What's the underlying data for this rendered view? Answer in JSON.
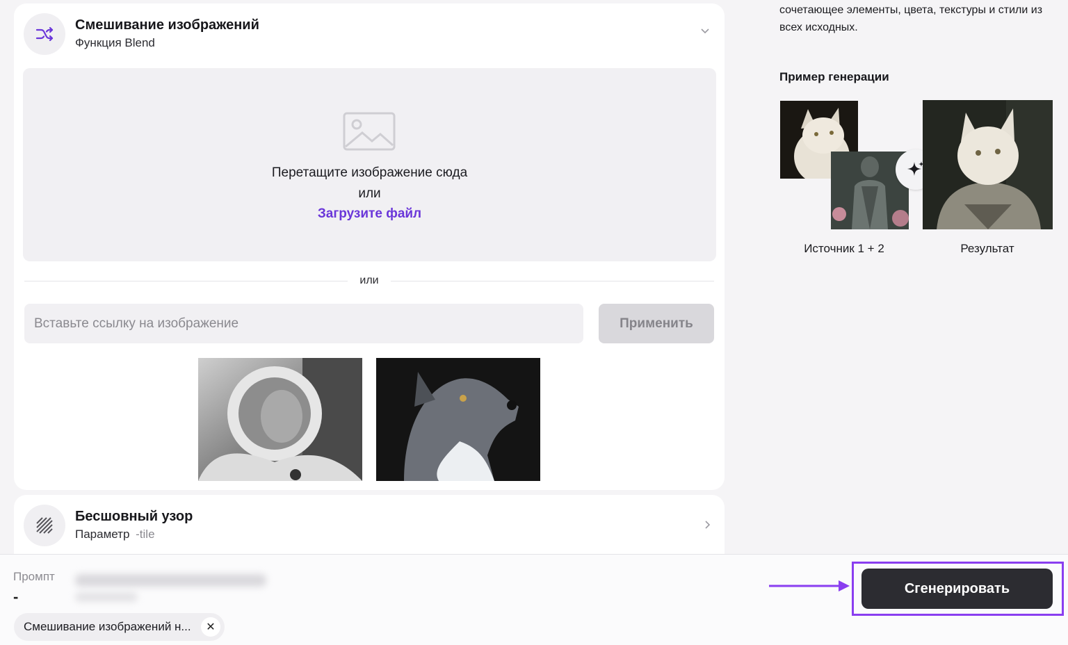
{
  "blend_section": {
    "title": "Смешивание изображений",
    "subtitle": "Функция Blend",
    "dropzone": {
      "line1": "Перетащите изображение сюда",
      "line2": "или",
      "upload_link": "Загрузите файл"
    },
    "divider": "или",
    "url_input_placeholder": "Вставьте ссылку на изображение",
    "apply_label": "Применить"
  },
  "pattern_section": {
    "title": "Бесшовный узор",
    "subtitle_prefix": "Параметр",
    "subtitle_param": "-tile"
  },
  "example": {
    "description": "сочетающее элементы, цвета, текстуры и стили из всех исходных.",
    "title": "Пример генерации",
    "source_caption": "Источник 1 + 2",
    "result_caption": "Результат"
  },
  "bottom_bar": {
    "prompt_label": "Промпт",
    "prompt_value": "-",
    "chip_label": "Смешивание изображений н...",
    "generate_label": "Сгенерировать"
  },
  "colors": {
    "accent": "#6a36d9",
    "highlight": "#8a3ef0",
    "button_dark": "#2c2c31"
  },
  "icons": [
    "shuffle-icon",
    "chevron-down-icon",
    "image-placeholder-icon",
    "stripes-icon",
    "chevron-right-icon",
    "sparkle-icon",
    "close-icon",
    "arrow-right-icon"
  ]
}
